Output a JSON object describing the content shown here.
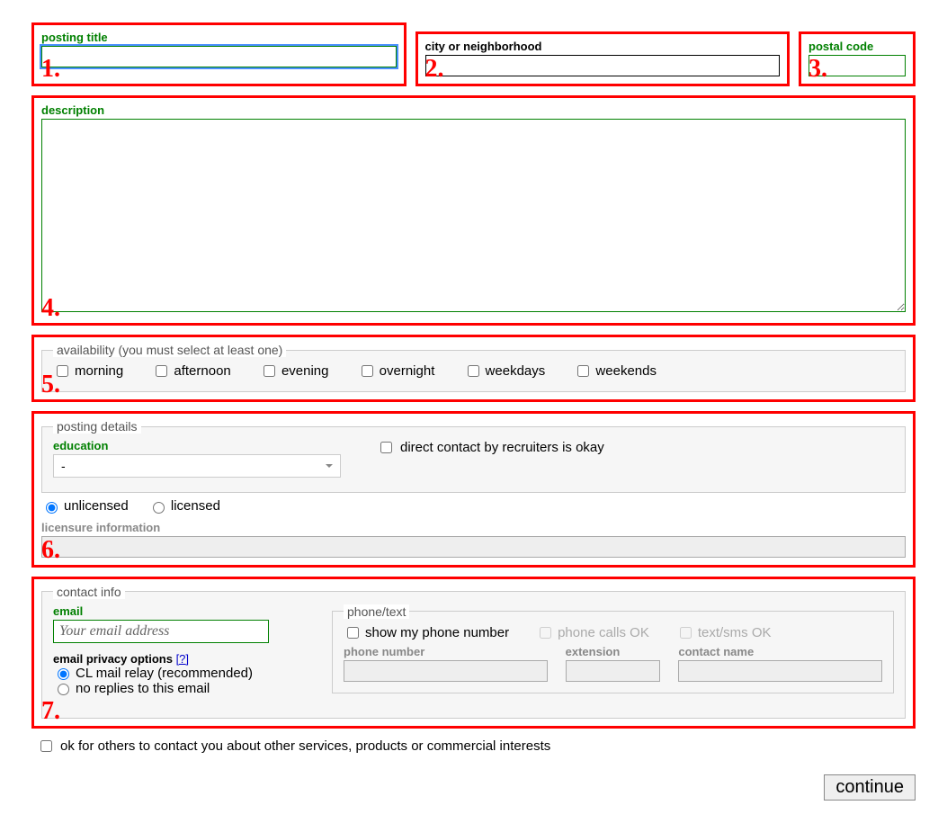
{
  "annotations": [
    "1.",
    "2.",
    "3.",
    "4.",
    "5.",
    "6.",
    "7."
  ],
  "top": {
    "posting_title_label": "posting title",
    "city_label": "city or neighborhood",
    "postal_label": "postal code"
  },
  "description_label": "description",
  "availability": {
    "legend": "availability (you must select at least one)",
    "options": [
      "morning",
      "afternoon",
      "evening",
      "overnight",
      "weekdays",
      "weekends"
    ]
  },
  "posting_details": {
    "legend": "posting details",
    "education_label": "education",
    "education_value": "-",
    "recruiters_label": "direct contact by recruiters is okay",
    "license_options": [
      "unlicensed",
      "licensed"
    ],
    "licensure_label": "licensure information"
  },
  "contact": {
    "legend": "contact info",
    "email_label": "email",
    "email_placeholder": "Your email address",
    "privacy_label": "email privacy options",
    "privacy_help": "[?]",
    "privacy_options": [
      "CL mail relay (recommended)",
      "no replies to this email"
    ],
    "phone_legend": "phone/text",
    "show_phone_label": "show my phone number",
    "calls_ok_label": "phone calls OK",
    "text_ok_label": "text/sms OK",
    "phone_number_label": "phone number",
    "ext_label": "extension",
    "contact_name_label": "contact name"
  },
  "ok_others_label": "ok for others to contact you about other services, products or commercial interests",
  "continue_label": "continue"
}
